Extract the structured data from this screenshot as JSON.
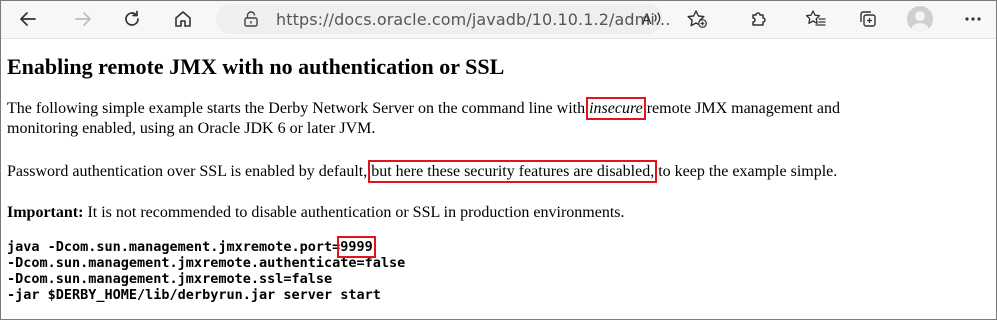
{
  "browser": {
    "url": "https://docs.oracle.com/javadb/10.10.1.2/admi...",
    "icons": {
      "back": "back-arrow-icon",
      "forward": "forward-arrow-icon",
      "refresh": "refresh-icon",
      "home": "home-icon",
      "info": "lock-info-icon",
      "read_aloud": "read-aloud-icon",
      "favorite": "add-favorite-icon",
      "extensions": "extensions-icon",
      "favorites": "favorites-icon",
      "collections": "collections-icon",
      "profile": "profile-avatar-icon",
      "menu": "more-menu-icon"
    }
  },
  "page": {
    "heading": "Enabling remote JMX with no authentication or SSL",
    "para1": {
      "before": "The following simple example starts the Derby Network Server on the command line with ",
      "highlight": "insecure",
      "after": " remote JMX management and",
      "line2": "monitoring enabled, using an Oracle JDK 6 or later JVM."
    },
    "para2": {
      "before": "Password authentication over SSL is enabled by default, ",
      "highlight": "but here these security features are disabled,",
      "after": " to keep the example simple."
    },
    "para3": {
      "label": "Important:",
      "text": " It is not recommended to disable authentication or SSL in production environments."
    },
    "code": {
      "line1_before": "java -Dcom.sun.management.jmxremote.port=",
      "line1_highlight": "9999",
      "line2": "-Dcom.sun.management.jmxremote.authenticate=false",
      "line3": "-Dcom.sun.management.jmxremote.ssl=false",
      "line4": "-jar $DERBY_HOME/lib/derbyrun.jar server start"
    }
  },
  "colors": {
    "highlight_border": "#e0141b",
    "toolbar_bg": "#f7f7f7",
    "address_bg": "#efefef"
  }
}
